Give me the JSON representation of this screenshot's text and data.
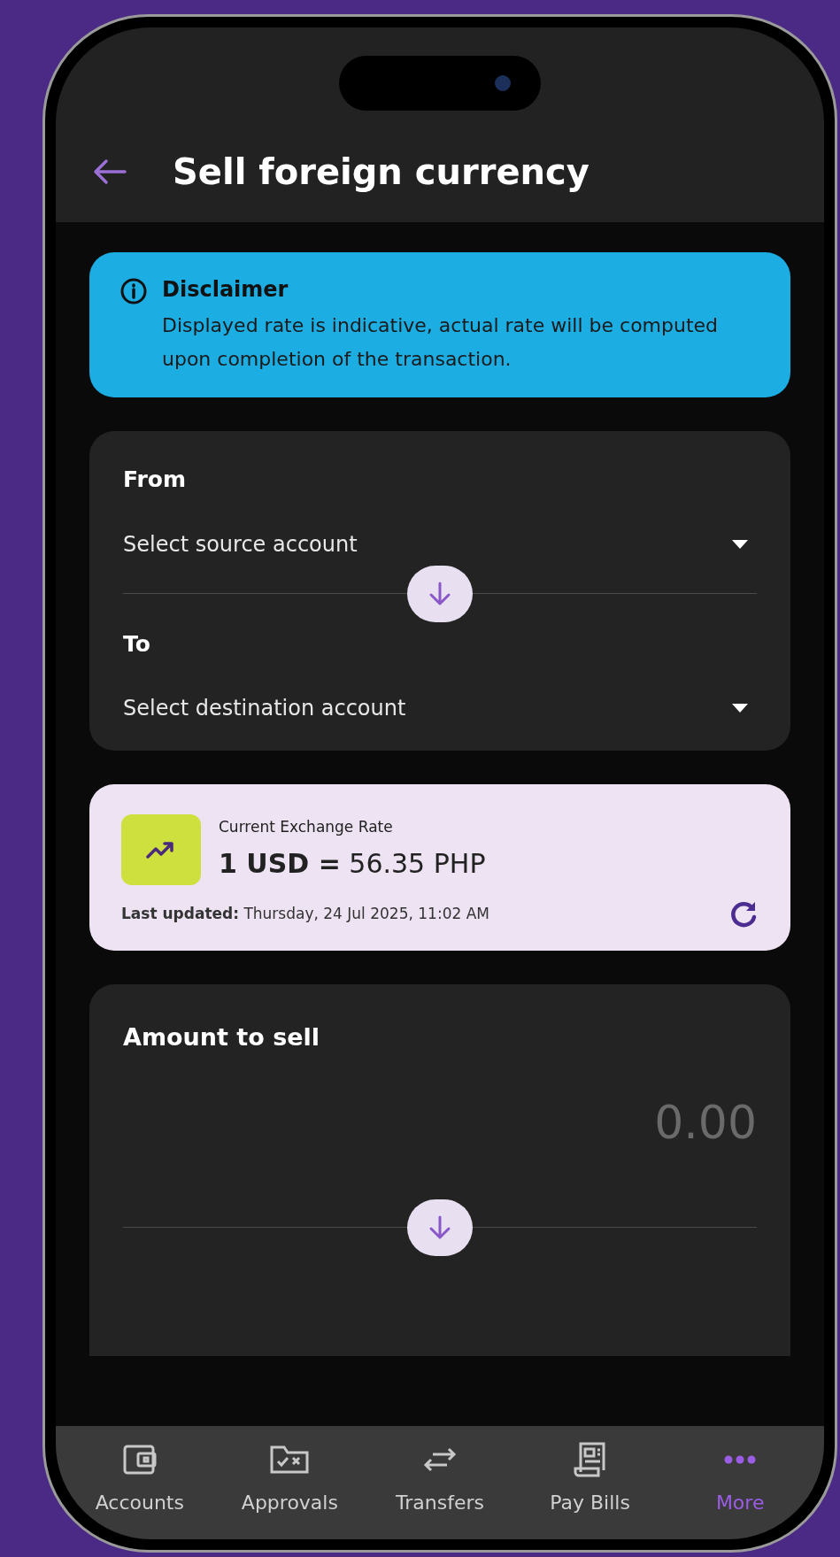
{
  "header": {
    "title": "Sell foreign currency"
  },
  "disclaimer": {
    "title": "Disclaimer",
    "text": "Displayed rate is indicative, actual rate will be computed upon completion of the transaction."
  },
  "accounts": [
    {
      "label": "From",
      "placeholder": "Select source account"
    },
    {
      "label": "To",
      "placeholder": "Select destination account"
    }
  ],
  "exchange_rate": {
    "label": "Current Exchange Rate",
    "rate": "**1 USD =** 56.35 PHP",
    "updated": "**Last updated:** Thursday, 24 Jul 2025, 11:02 AM"
  },
  "amount": {
    "label": "Amount to sell",
    "placeholder": "0.00"
  },
  "nav": [
    {
      "label": "Accounts",
      "kind": "wallet",
      "selected": false
    },
    {
      "label": "Approvals",
      "kind": "folder",
      "selected": false
    },
    {
      "label": "Transfers",
      "kind": "arrows",
      "selected": false
    },
    {
      "label": "Pay Bills",
      "kind": "receipt",
      "selected": false
    },
    {
      "label": "More",
      "kind": "dots",
      "selected": true
    }
  ]
}
